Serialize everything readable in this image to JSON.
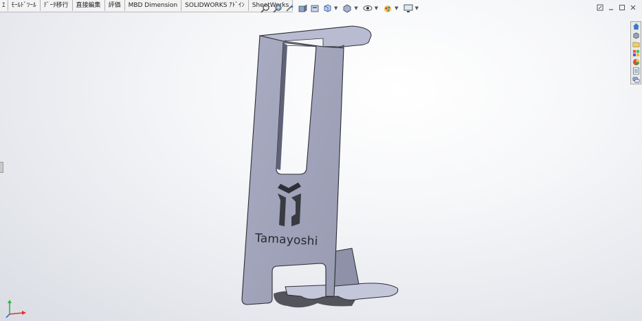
{
  "command_tabs": [
    {
      "label": "ｴ"
    },
    {
      "label": "ﾓｰﾙﾄﾞﾂｰﾙ"
    },
    {
      "label": "ﾃﾞｰﾀ移行"
    },
    {
      "label": "直接編集"
    },
    {
      "label": "評価"
    },
    {
      "label": "MBD Dimension"
    },
    {
      "label": "SOLIDWORKS ｱﾄﾞｲﾝ"
    },
    {
      "label": "SheetWorks"
    }
  ],
  "heads_up_toolbar": {
    "icons": [
      "zoom-to-fit-icon",
      "zoom-to-area-icon",
      "previous-view-icon",
      "section-view-icon",
      "dynamic-annotation-icon",
      "view-orientation-icon",
      "display-style-icon",
      "hide-show-items-icon",
      "edit-appearance-icon",
      "apply-scene-icon",
      "view-settings-icon"
    ]
  },
  "window_controls": [
    "restore-icon",
    "minimize-icon",
    "maximize-icon",
    "close-icon"
  ],
  "task_pane": [
    "home-icon",
    "3d-parts-icon",
    "file-explorer-icon",
    "view-palette-icon",
    "appearances-icon",
    "custom-properties-icon",
    "forum-icon"
  ],
  "model": {
    "engraved_text": "Tamayoshi",
    "colors": {
      "face": "#a4a7bc",
      "edge": "#2b2c34",
      "top": "#b9bcd0",
      "shadow": "#3a3b42"
    }
  }
}
